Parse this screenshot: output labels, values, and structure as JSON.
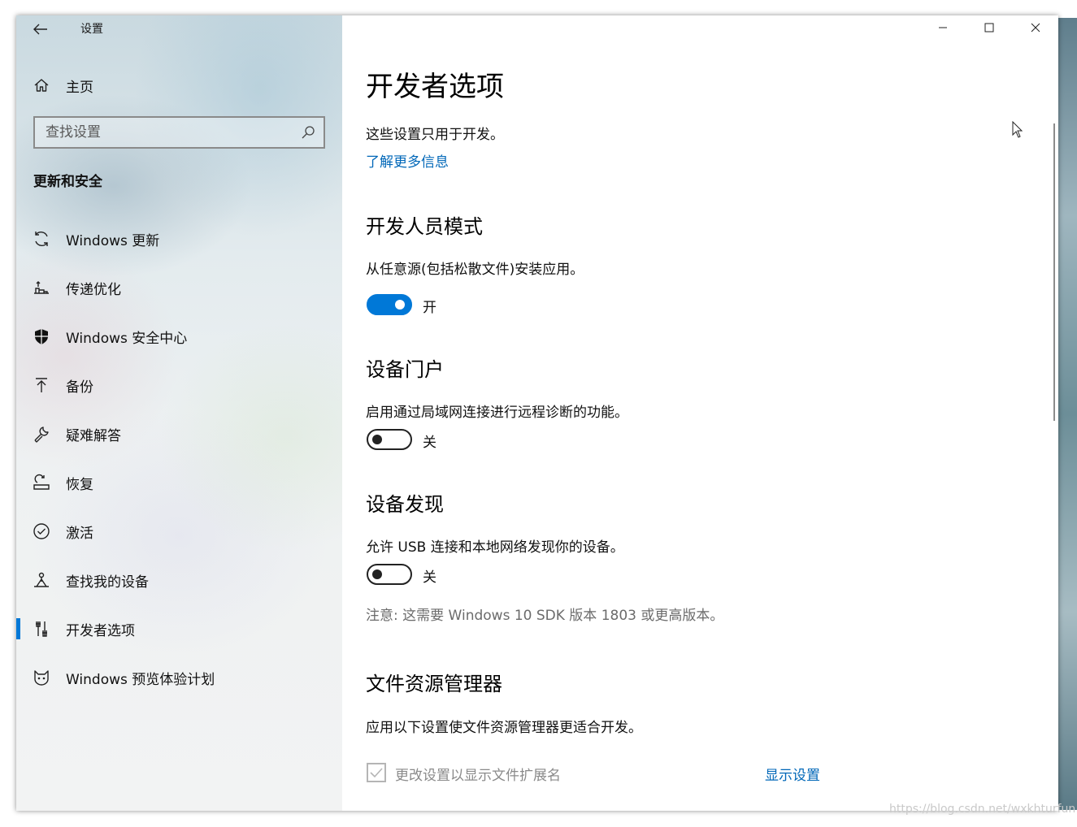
{
  "titlebar": {
    "title": "设置"
  },
  "sidebar": {
    "home_label": "主页",
    "search_placeholder": "查找设置",
    "section_header": "更新和安全",
    "items": [
      {
        "label": "Windows 更新",
        "icon": "refresh-icon"
      },
      {
        "label": "传递优化",
        "icon": "delivery-optimization-icon"
      },
      {
        "label": "Windows 安全中心",
        "icon": "shield-icon"
      },
      {
        "label": "备份",
        "icon": "upload-arrow-icon"
      },
      {
        "label": "疑难解答",
        "icon": "wrench-icon"
      },
      {
        "label": "恢复",
        "icon": "recovery-icon"
      },
      {
        "label": "激活",
        "icon": "check-circle-icon"
      },
      {
        "label": "查找我的设备",
        "icon": "find-device-icon"
      },
      {
        "label": "开发者选项",
        "icon": "developer-tools-icon",
        "active": true
      },
      {
        "label": "Windows 预览体验计划",
        "icon": "insider-cat-icon"
      }
    ]
  },
  "content": {
    "title": "开发者选项",
    "intro": "这些设置只用于开发。",
    "learn_more": "了解更多信息",
    "dev_mode": {
      "heading": "开发人员模式",
      "description": "从任意源(包括松散文件)安装应用。",
      "state": "开"
    },
    "device_portal": {
      "heading": "设备门户",
      "description": "启用通过局域网连接进行远程诊断的功能。",
      "state": "关"
    },
    "device_discovery": {
      "heading": "设备发现",
      "description": "允许 USB 连接和本地网络发现你的设备。",
      "state": "关",
      "note": "注意: 这需要 Windows 10 SDK 版本 1803 或更高版本。"
    },
    "file_explorer": {
      "heading": "文件资源管理器",
      "description": "应用以下设置使文件资源管理器更适合开发。",
      "checkbox_label": "更改设置以显示文件扩展名",
      "show_settings": "显示设置"
    }
  },
  "colors": {
    "accent": "#0078d7",
    "link": "#0067b8"
  },
  "watermark": "https://blog.csdn.net/wxkhturfun"
}
